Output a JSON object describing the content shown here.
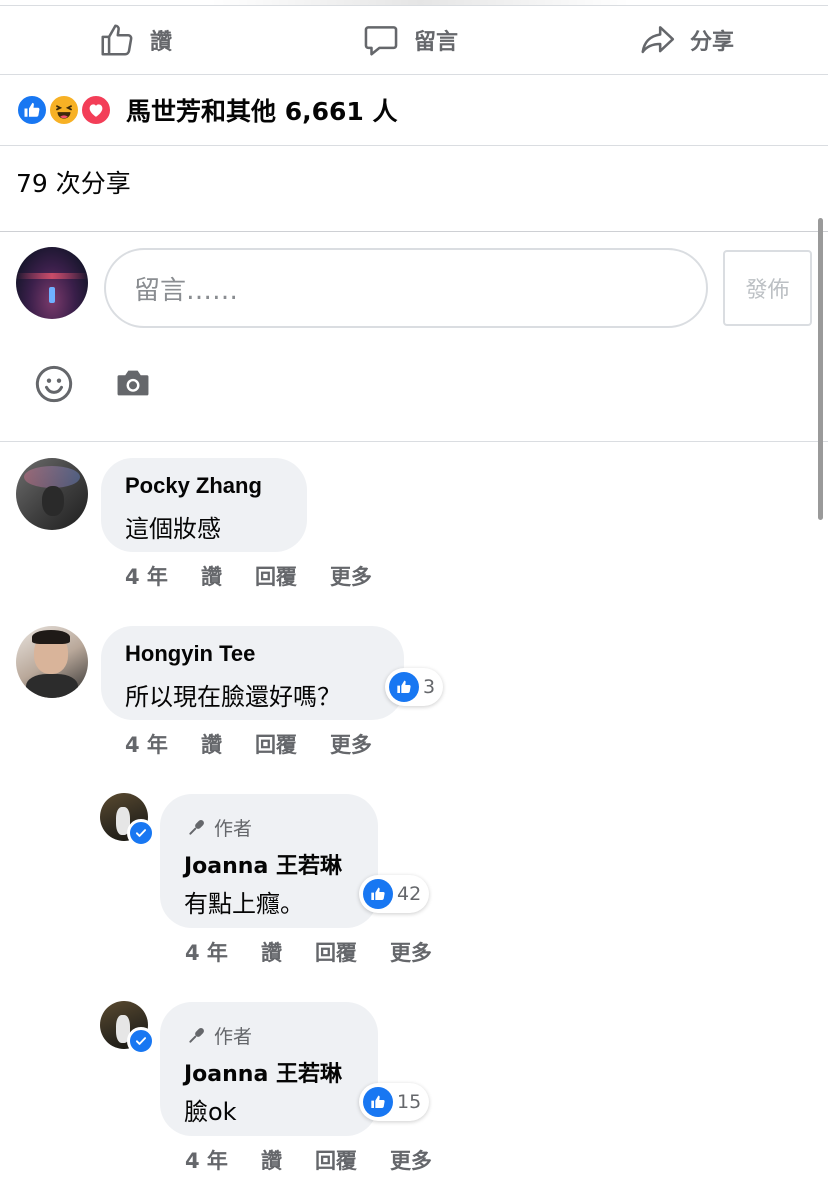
{
  "actions": {
    "like_label": "讚",
    "comment_label": "留言",
    "share_label": "分享"
  },
  "reactions": {
    "icons": [
      "like-icon",
      "haha-icon",
      "love-icon"
    ],
    "summary": "馬世芳和其他 6,661 人"
  },
  "shares": {
    "text": "79 次分享"
  },
  "composer": {
    "placeholder": "留言……",
    "post_label": "發佈",
    "icons": [
      "emoji-icon",
      "camera-icon"
    ]
  },
  "comments": [
    {
      "name": "Pocky Zhang",
      "text": "這個妝感",
      "time": "4 年",
      "like": "讚",
      "reply": "回覆",
      "more": "更多"
    },
    {
      "name": "Hongyin Tee",
      "text": "所以現在臉還好嗎？",
      "likes": "3",
      "time": "4 年",
      "like": "讚",
      "reply": "回覆",
      "more": "更多"
    }
  ],
  "replies": [
    {
      "badge": "作者",
      "name": "Joanna 王若琳",
      "text": "有點上癮。",
      "likes": "42",
      "time": "4 年",
      "like": "讚",
      "reply": "回覆",
      "more": "更多"
    },
    {
      "badge": "作者",
      "name": "Joanna 王若琳",
      "text": "臉ok",
      "likes": "15",
      "time": "4 年",
      "like": "讚",
      "reply": "回覆",
      "more": "更多"
    }
  ],
  "colors": {
    "accent": "#1877f2",
    "bubble": "#eff1f4",
    "secondary_text": "#65676b",
    "divider": "#dadde1"
  }
}
